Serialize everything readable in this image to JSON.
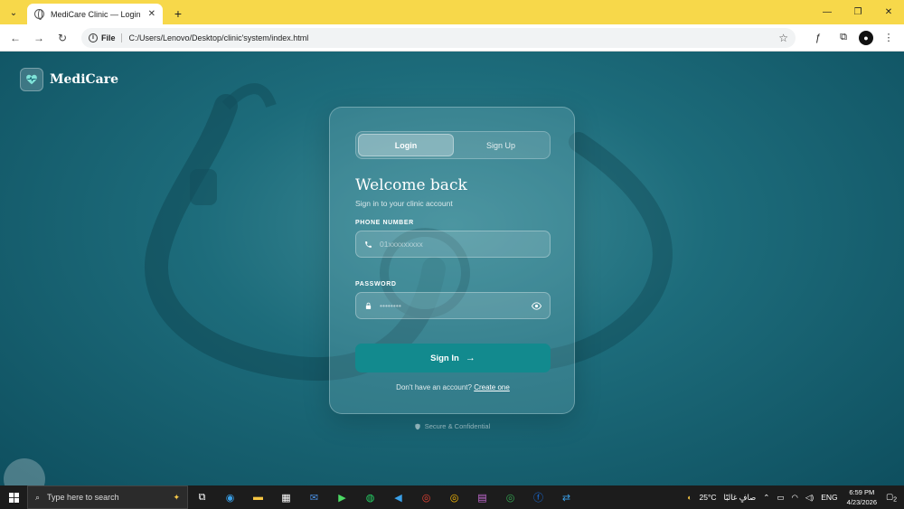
{
  "browser": {
    "tab_title": "MediCare Clinic — Login",
    "url_chip": "File",
    "url": "C:/Users/Lenovo/Desktop/clinic'system/index.html"
  },
  "brand": {
    "name": "MediCare"
  },
  "auth": {
    "tabs": [
      {
        "label": "Login",
        "active": true
      },
      {
        "label": "Sign Up",
        "active": false
      }
    ],
    "title": "Welcome back",
    "subtitle": "Sign in to your clinic account",
    "phone_label": "PHONE NUMBER",
    "phone_placeholder": "01xxxxxxxxx",
    "password_label": "PASSWORD",
    "password_placeholder": "••••••••",
    "submit_label": "Sign In",
    "footer_text": "Don't have an account?",
    "footer_link": "Create one",
    "secure_text": "Secure & Confidential"
  },
  "taskbar": {
    "search_placeholder": "Type here to search",
    "weather": "25°C",
    "weather_desc": "صافٍ غالبًا",
    "lang": "ENG",
    "time": "6:59 PM",
    "date": "4/23/2026",
    "notif_count": "2"
  },
  "colors": {
    "accent": "#128a8e",
    "tabbar": "#f7d84a"
  }
}
